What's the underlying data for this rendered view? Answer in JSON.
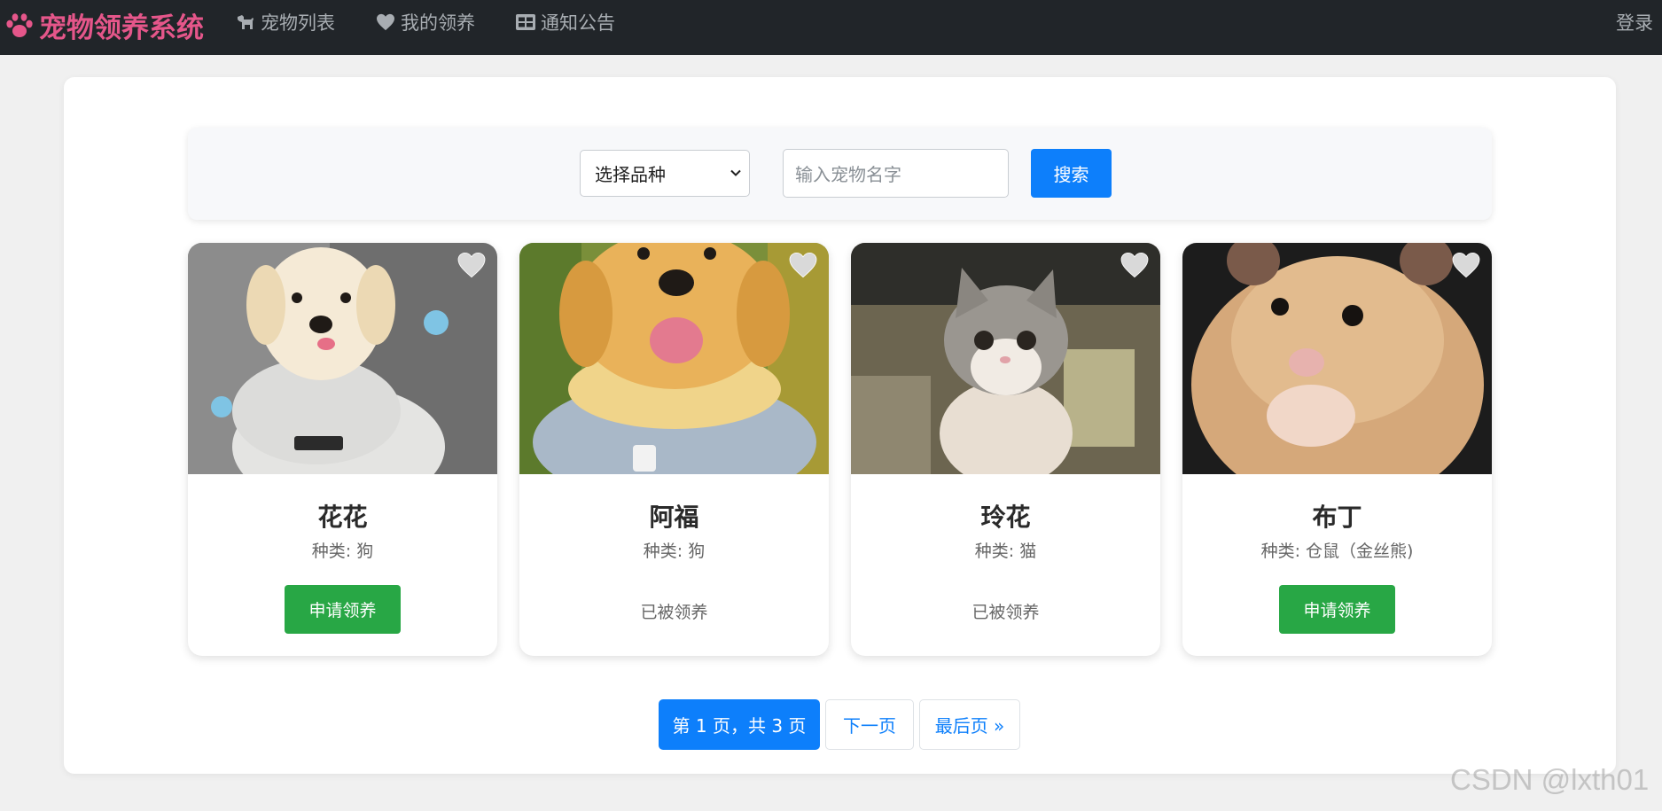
{
  "navbar": {
    "brand": "宠物领养系统",
    "links": [
      {
        "label": "宠物列表",
        "icon": "dog-icon"
      },
      {
        "label": "我的领养",
        "icon": "heart-icon"
      },
      {
        "label": "通知公告",
        "icon": "table-icon"
      }
    ],
    "login": "登录"
  },
  "search": {
    "select_value": "选择品种",
    "input_placeholder": "输入宠物名字",
    "button": "搜索"
  },
  "pets": [
    {
      "name": "花花",
      "kind": "种类: 狗",
      "action": "申请领养",
      "adopted": false
    },
    {
      "name": "阿福",
      "kind": "种类: 狗",
      "status": "已被领养",
      "adopted": true
    },
    {
      "name": "玲花",
      "kind": "种类: 猫",
      "status": "已被领养",
      "adopted": true
    },
    {
      "name": "布丁",
      "kind": "种类: 仓鼠（金丝熊)",
      "action": "申请领养",
      "adopted": false
    }
  ],
  "pagination": {
    "current": "第 1 页，共 3 页",
    "next": "下一页",
    "last": "最后页 »"
  },
  "watermark": "CSDN @lxth01",
  "colors": {
    "navbar_bg": "#212529",
    "brand": "#e5568a",
    "primary": "#0d7ffb",
    "success": "#28a745"
  }
}
